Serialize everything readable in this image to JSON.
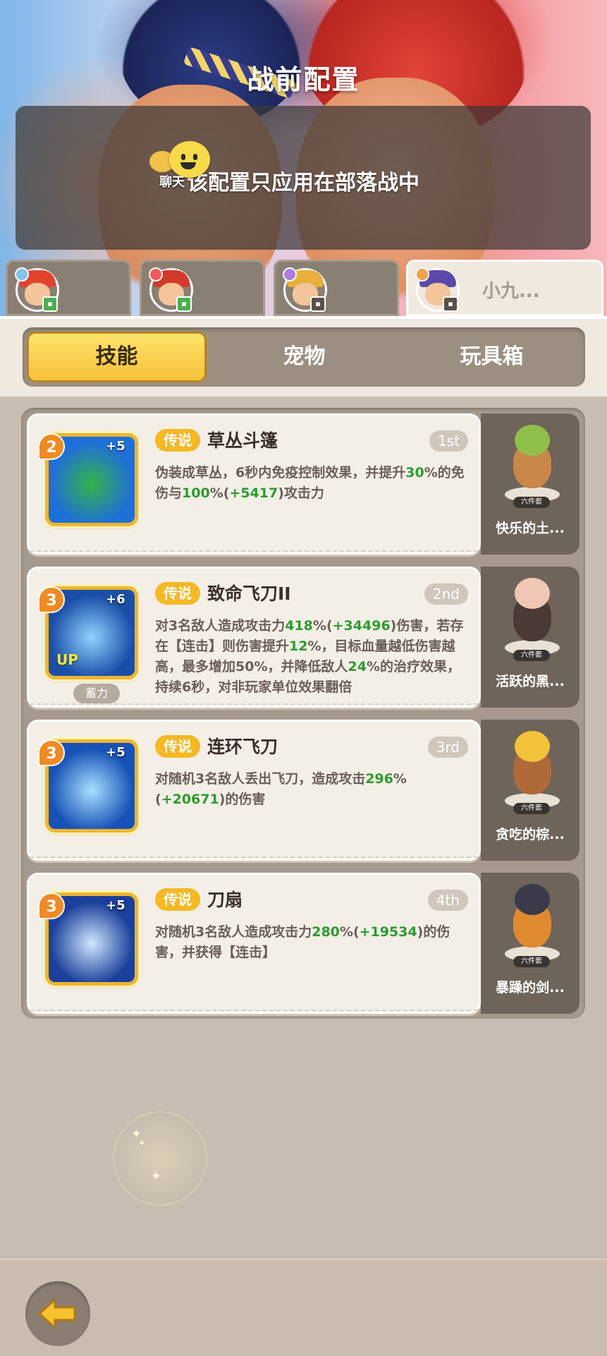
{
  "header": {
    "title": "战前配置",
    "notice": "该配置只应用在部落战中",
    "chat_label": "聊天"
  },
  "players": [
    {
      "name": "",
      "active": false,
      "hair": "#e0442f",
      "dot": "#7fc3f0",
      "badge": "#4caf50"
    },
    {
      "name": "",
      "active": false,
      "hair": "#d23a2a",
      "dot": "#f05a5a",
      "badge": "#4caf50"
    },
    {
      "name": "",
      "active": false,
      "hair": "#e8b03a",
      "dot": "#b07ae0",
      "badge": "#5a5048"
    },
    {
      "name": "小九...",
      "active": true,
      "hair": "#5b4aa8",
      "dot": "#f0a24a",
      "badge": "#5a5048"
    }
  ],
  "tabs": [
    "技能",
    "宠物",
    "玩具箱"
  ],
  "active_tab": 0,
  "skills": [
    {
      "level": "2",
      "plus": "+5",
      "rarity": "传说",
      "name": "草丛斗篷",
      "rank": "1st",
      "desc": [
        {
          "t": "伪装成草丛，6秒内免疫控制效果，并提升"
        },
        {
          "t": "30",
          "g": true
        },
        {
          "t": "%的免伤与"
        },
        {
          "t": "100",
          "g": true
        },
        {
          "t": "%("
        },
        {
          "t": "+5417",
          "g": true
        },
        {
          "t": ")攻击力"
        }
      ],
      "icon_colors": [
        "#1f6fd8",
        "#35b44a"
      ],
      "up": "",
      "charge": ""
    },
    {
      "level": "3",
      "plus": "+6",
      "rarity": "传说",
      "name": "致命飞刀II",
      "rank": "2nd",
      "desc": [
        {
          "t": "对3名敌人造成攻击力"
        },
        {
          "t": "418",
          "g": true
        },
        {
          "t": "%("
        },
        {
          "t": "+34496",
          "g": true
        },
        {
          "t": ")伤害，若存在【连击】则伤害提升"
        },
        {
          "t": "12",
          "g": true
        },
        {
          "t": "%，目标血量越低伤害越高，最多增加50%，并降低敌人"
        },
        {
          "t": "24",
          "g": true
        },
        {
          "t": "%的治疗效果，持续6秒，对非玩家单位效果翻倍"
        }
      ],
      "icon_colors": [
        "#1a4fa8",
        "#8fd3ff"
      ],
      "up": "UP",
      "charge": "蓄力"
    },
    {
      "level": "3",
      "plus": "+5",
      "rarity": "传说",
      "name": "连环飞刀",
      "rank": "3rd",
      "desc": [
        {
          "t": "对随机3名敌人丢出飞刀，造成攻击"
        },
        {
          "t": "296",
          "g": true
        },
        {
          "t": "%("
        },
        {
          "t": "+20671",
          "g": true
        },
        {
          "t": ")的伤害"
        }
      ],
      "icon_colors": [
        "#1753b6",
        "#a8e0ff"
      ],
      "up": "",
      "charge": ""
    },
    {
      "level": "3",
      "plus": "+5",
      "rarity": "传说",
      "name": "刀扇",
      "rank": "4th",
      "desc": [
        {
          "t": "对随机3名敌人造成攻击力"
        },
        {
          "t": "280",
          "g": true
        },
        {
          "t": "%("
        },
        {
          "t": "+19534",
          "g": true
        },
        {
          "t": ")的伤害，并获得【连击】"
        }
      ],
      "icon_colors": [
        "#1b3f9a",
        "#cfe8ff"
      ],
      "up": "",
      "charge": ""
    }
  ],
  "pets": [
    {
      "name": "快乐的土...",
      "tag": "六件套",
      "body": "#c9874a",
      "head": "#8fbf4a"
    },
    {
      "name": "活跃的黑...",
      "tag": "六件套",
      "body": "#4a3a36",
      "head": "#f0c7b4"
    },
    {
      "name": "贪吃的棕...",
      "tag": "六件套",
      "body": "#b06a3a",
      "head": "#f2c23a"
    },
    {
      "name": "暴躁的剑...",
      "tag": "六件套",
      "body": "#e08a30",
      "head": "#3a3a4a"
    }
  ]
}
